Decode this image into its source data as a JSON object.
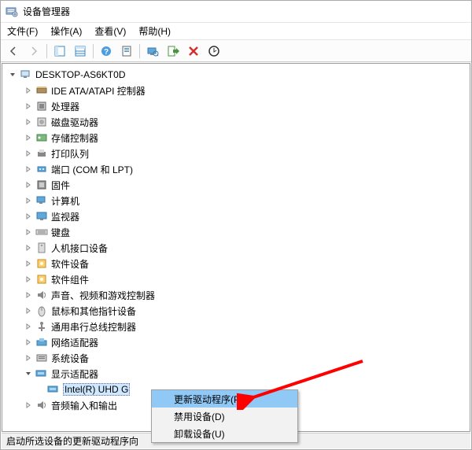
{
  "window": {
    "title": "设备管理器"
  },
  "menu": {
    "file": "文件(F)",
    "action": "操作(A)",
    "view": "查看(V)",
    "help": "帮助(H)"
  },
  "tree": {
    "root": "DESKTOP-AS6KT0D",
    "items": [
      {
        "label": "IDE ATA/ATAPI 控制器",
        "icon": "ide"
      },
      {
        "label": "处理器",
        "icon": "cpu"
      },
      {
        "label": "磁盘驱动器",
        "icon": "disk"
      },
      {
        "label": "存储控制器",
        "icon": "storage"
      },
      {
        "label": "打印队列",
        "icon": "printer"
      },
      {
        "label": "端口 (COM 和 LPT)",
        "icon": "port"
      },
      {
        "label": "固件",
        "icon": "firmware"
      },
      {
        "label": "计算机",
        "icon": "computer"
      },
      {
        "label": "监视器",
        "icon": "monitor"
      },
      {
        "label": "键盘",
        "icon": "keyboard"
      },
      {
        "label": "人机接口设备",
        "icon": "hid"
      },
      {
        "label": "软件设备",
        "icon": "software"
      },
      {
        "label": "软件组件",
        "icon": "software"
      },
      {
        "label": "声音、视频和游戏控制器",
        "icon": "sound"
      },
      {
        "label": "鼠标和其他指针设备",
        "icon": "mouse"
      },
      {
        "label": "通用串行总线控制器",
        "icon": "usb"
      },
      {
        "label": "网络适配器",
        "icon": "network"
      },
      {
        "label": "系统设备",
        "icon": "system"
      }
    ],
    "display_adapters": {
      "label": "显示适配器",
      "child": "Intel(R) UHD G"
    },
    "audio": {
      "label": "音频输入和输出"
    }
  },
  "context_menu": {
    "update": "更新驱动程序(P)",
    "disable": "禁用设备(D)",
    "uninstall": "卸载设备(U)"
  },
  "statusbar": {
    "text": "启动所选设备的更新驱动程序向"
  }
}
